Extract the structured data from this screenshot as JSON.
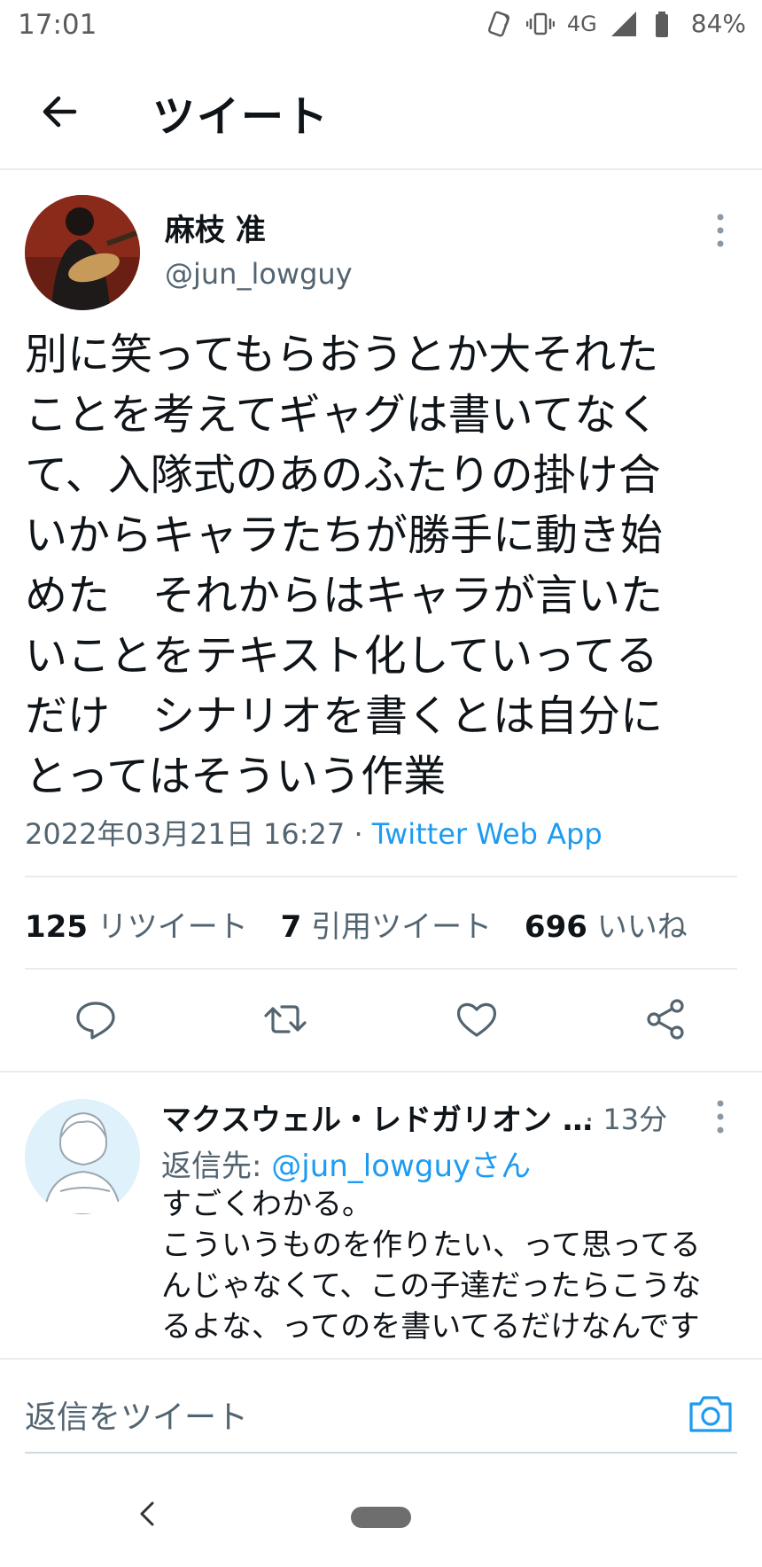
{
  "status_bar": {
    "time": "17:01",
    "network": "4G",
    "battery": "84%"
  },
  "header": {
    "title": "ツイート"
  },
  "tweet": {
    "author_name": "麻枝 准",
    "author_handle": "@jun_lowguy",
    "text_lines": [
      "別に笑ってもらおうとか大それた",
      "ことを考えてギャグは書いてなく",
      "て、入隊式のあのふたりの掛け合",
      "いからキャラたちが勝手に動き始",
      "めた　それからはキャラが言いた",
      "いことをテキスト化していってる",
      "だけ　シナリオを書くとは自分に",
      "とってはそういう作業"
    ],
    "timestamp": "2022年03月21日 16:27",
    "separator": " · ",
    "source": "Twitter Web App",
    "retweets_count": "125",
    "retweets_label": "リツイート",
    "quotes_count": "7",
    "quotes_label": "引用ツイート",
    "likes_count": "696",
    "likes_label": "いいね"
  },
  "actions": [
    "reply-icon",
    "retweet-icon",
    "like-icon",
    "share-icon"
  ],
  "reply": {
    "author_name": "マクスウェル・レドガリオン …",
    "time": "· 13分",
    "reply_to_prefix": "返信先: ",
    "reply_to_handle": "@jun_lowguyさん",
    "text": "すごくわかる。\nこういうものを作りたい、って思ってる\nんじゃなくて、この子達だったらこうな\nるよな、ってのを書いてるだけなんです"
  },
  "composer": {
    "placeholder": "返信をツイート"
  },
  "colors": {
    "accent": "#1d9bf0",
    "secondary_text": "#536471",
    "border": "#e6ecf0"
  }
}
